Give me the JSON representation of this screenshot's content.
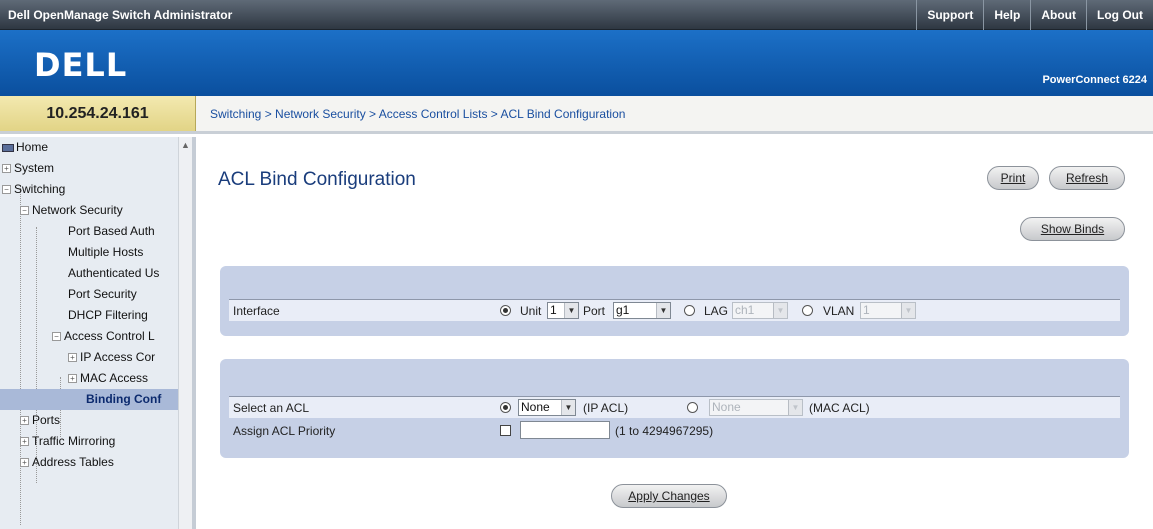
{
  "topbar": {
    "title": "Dell OpenManage Switch Administrator",
    "links": [
      "Support",
      "Help",
      "About",
      "Log Out"
    ]
  },
  "banner": {
    "logo": "DELL",
    "product": "PowerConnect 6224"
  },
  "ip_address": "10.254.24.161",
  "breadcrumb": {
    "text": "Switching > Network Security > Access Control Lists > ACL Bind Configuration"
  },
  "sidebar": {
    "items": [
      {
        "label": "Home",
        "level": 0
      },
      {
        "label": "System",
        "level": 0
      },
      {
        "label": "Switching",
        "level": 0
      },
      {
        "label": "Network Security",
        "level": 1
      },
      {
        "label": "Port Based Auth",
        "level": 2
      },
      {
        "label": "Multiple Hosts",
        "level": 2
      },
      {
        "label": "Authenticated Us",
        "level": 2
      },
      {
        "label": "Port Security",
        "level": 2
      },
      {
        "label": "DHCP Filtering",
        "level": 2
      },
      {
        "label": "Access Control L",
        "level": 2
      },
      {
        "label": "IP Access Cor",
        "level": 3
      },
      {
        "label": "MAC Access",
        "level": 3
      },
      {
        "label": "Binding Conf",
        "level": 3
      },
      {
        "label": "Ports",
        "level": 0
      },
      {
        "label": "Traffic Mirroring",
        "level": 0
      },
      {
        "label": "Address Tables",
        "level": 0
      }
    ]
  },
  "page": {
    "title": "ACL Bind Configuration",
    "print_label": "Print",
    "refresh_label": "Refresh",
    "show_binds_label": "Show Binds",
    "apply_label": "Apply Changes"
  },
  "interface_row": {
    "label": "Interface",
    "unit_label": "Unit",
    "unit_value": "1",
    "port_label": "Port",
    "port_value": "g1",
    "lag_label": "LAG",
    "lag_value": "ch1",
    "vlan_label": "VLAN",
    "vlan_value": "1"
  },
  "acl_rows": {
    "select_label": "Select an ACL",
    "ip_acl_value": "None",
    "ip_acl_suffix": "(IP ACL)",
    "mac_acl_value": "None",
    "mac_acl_suffix": "(MAC ACL)",
    "priority_label": "Assign ACL Priority",
    "priority_value": "",
    "priority_range": "(1 to 4294967295)"
  }
}
